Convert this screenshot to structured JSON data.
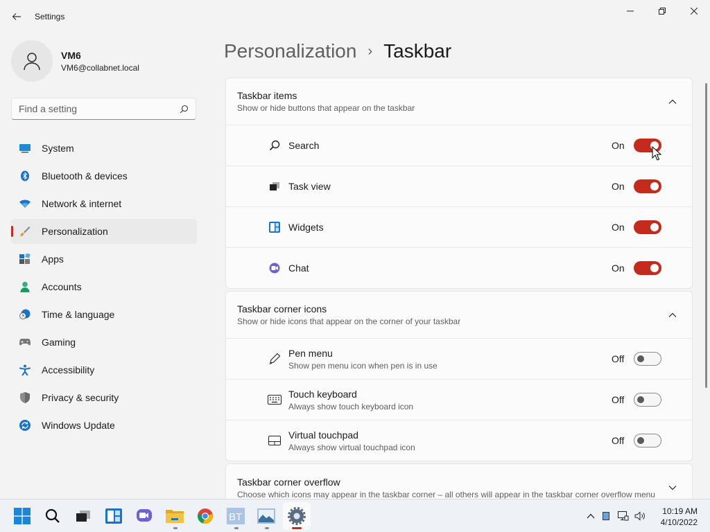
{
  "window": {
    "title": "Settings"
  },
  "profile": {
    "name": "VM6",
    "email": "VM6@collabnet.local"
  },
  "search": {
    "placeholder": "Find a setting"
  },
  "sidebar": {
    "items": [
      {
        "label": "System",
        "icon": "system-icon"
      },
      {
        "label": "Bluetooth & devices",
        "icon": "bluetooth-icon"
      },
      {
        "label": "Network & internet",
        "icon": "wifi-icon"
      },
      {
        "label": "Personalization",
        "icon": "brush-icon",
        "active": true
      },
      {
        "label": "Apps",
        "icon": "apps-icon"
      },
      {
        "label": "Accounts",
        "icon": "person-icon"
      },
      {
        "label": "Time & language",
        "icon": "clock-globe-icon"
      },
      {
        "label": "Gaming",
        "icon": "gamepad-icon"
      },
      {
        "label": "Accessibility",
        "icon": "accessibility-icon"
      },
      {
        "label": "Privacy & security",
        "icon": "shield-icon"
      },
      {
        "label": "Windows Update",
        "icon": "update-icon"
      }
    ]
  },
  "breadcrumb": {
    "parent": "Personalization",
    "separator": "›",
    "current": "Taskbar"
  },
  "taskbar_items": {
    "title": "Taskbar items",
    "subtitle": "Show or hide buttons that appear on the taskbar",
    "rows": [
      {
        "label": "Search",
        "state": "On",
        "on": true,
        "icon": "search-icon"
      },
      {
        "label": "Task view",
        "state": "On",
        "on": true,
        "icon": "task-view-icon"
      },
      {
        "label": "Widgets",
        "state": "On",
        "on": true,
        "icon": "widgets-icon"
      },
      {
        "label": "Chat",
        "state": "On",
        "on": true,
        "icon": "chat-icon"
      }
    ]
  },
  "corner_icons": {
    "title": "Taskbar corner icons",
    "subtitle": "Show or hide icons that appear on the corner of your taskbar",
    "rows": [
      {
        "label": "Pen menu",
        "desc": "Show pen menu icon when pen is in use",
        "state": "Off",
        "on": false,
        "icon": "pen-icon"
      },
      {
        "label": "Touch keyboard",
        "desc": "Always show touch keyboard icon",
        "state": "Off",
        "on": false,
        "icon": "keyboard-icon"
      },
      {
        "label": "Virtual touchpad",
        "desc": "Always show virtual touchpad icon",
        "state": "Off",
        "on": false,
        "icon": "touchpad-icon"
      }
    ]
  },
  "corner_overflow": {
    "title": "Taskbar corner overflow",
    "subtitle": "Choose which icons may appear in the taskbar corner – all others will appear in the taskbar corner overflow menu"
  },
  "system_taskbar": {
    "apps": [
      "start-icon",
      "search-icon",
      "task-view-icon",
      "widgets-icon",
      "chat-icon",
      "file-explorer-icon",
      "chrome-icon",
      "bt-app-icon",
      "image-app-icon",
      "settings-icon"
    ],
    "time": "10:19 AM",
    "date": "4/10/2022"
  },
  "colors": {
    "accent": "#c42b1c",
    "background": "#f3f3f3",
    "card": "#fbfbfb"
  }
}
